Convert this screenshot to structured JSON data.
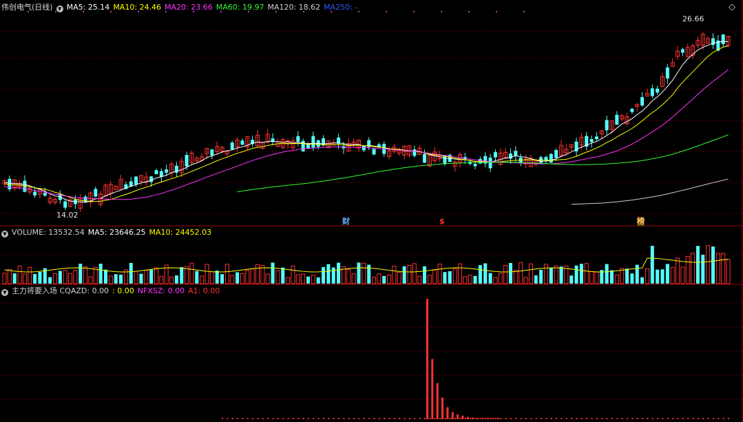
{
  "price_panel": {
    "stock_name": "伟创电气(日线)",
    "indicators": [
      {
        "label": "MA5: 25.14",
        "color": "#ffffff"
      },
      {
        "label": "MA10: 24.46",
        "color": "#ffff00"
      },
      {
        "label": "MA20: 23.66",
        "color": "#ff33ff"
      },
      {
        "label": "MA60: 19.97",
        "color": "#33ff33"
      },
      {
        "label": "MA120: 18.62",
        "color": "#d0d0d0"
      },
      {
        "label": "MA250: -",
        "color": "#3355ff"
      }
    ],
    "high_label": "26.66",
    "low_label": "14.02",
    "markers": [
      {
        "text": "财",
        "color": "#66aaff"
      },
      {
        "text": "$",
        "color": "#ff3333"
      },
      {
        "text": "榜",
        "color": "#ffcc66"
      }
    ]
  },
  "volume_panel": {
    "indicators": [
      {
        "label": "VOLUME: 13532.54",
        "color": "#d0d0d0"
      },
      {
        "label": "MA5: 23646.25",
        "color": "#ffffff"
      },
      {
        "label": "MA10: 24452.03",
        "color": "#ffff00"
      }
    ]
  },
  "indicator_panel": {
    "indicators": [
      {
        "label": "主力将要入场 CQAZD: 0.00",
        "color": "#d0d0d0"
      },
      {
        "label": ": 0.00",
        "color": "#ffff00"
      },
      {
        "label": "NFXSZ: 0.00",
        "color": "#ff33ff"
      },
      {
        "label": "A1: 0.00",
        "color": "#ff3333"
      }
    ]
  },
  "chart_data": [
    {
      "type": "candlestick",
      "series_count": 60,
      "y_range": [
        14.02,
        26.66
      ],
      "annotations": {
        "high": 26.66,
        "low": 14.02
      },
      "moving_averages": [
        "MA5",
        "MA10",
        "MA20",
        "MA60",
        "MA120",
        "MA250"
      ]
    },
    {
      "type": "bar",
      "name": "VOLUME",
      "value": 13532.54,
      "ma5": 23646.25,
      "ma10": 24452.03
    },
    {
      "type": "bar",
      "name": "CQAZD",
      "value": 0.0,
      "peak_relative_values": [
        1.0,
        0.5,
        0.3,
        0.18,
        0.1,
        0.06,
        0.04,
        0.03,
        0.02,
        0.015,
        0.01,
        0.01,
        0.01,
        0.01,
        0.01
      ]
    }
  ],
  "colors": {
    "up": "#ff3333",
    "down": "#54ffff",
    "grid": "#6b0000",
    "border": "#a00000"
  }
}
